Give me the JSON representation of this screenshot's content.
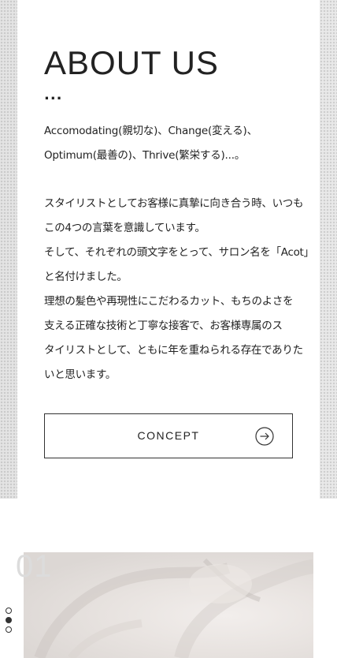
{
  "about": {
    "heading": "ABOUT US",
    "dots": "...",
    "intro": [
      "Accomodating(親切な)、Change(変える)、",
      "Optimum(最善の)、Thrive(繁栄する)...。"
    ],
    "body": [
      "スタイリストとしてお客様に真摯に向き合う時、いつも",
      "この4つの言葉を意識しています。",
      "そして、それぞれの頭文字をとって、サロン名を「Acot」",
      "と名付けました。",
      "理想の髪色や再現性にこだわるカット、もちのよさを",
      "支える正確な技術と丁寧な接客で、お客様専属のス",
      "タイリストとして、ともに年を重ねられる存在でありた",
      "いと思います。"
    ],
    "button": {
      "label": "CONCEPT",
      "icon": "arrow-right-circle-icon"
    }
  },
  "section": {
    "number": "01"
  },
  "pager": {
    "count": 3,
    "active_index": 1
  },
  "colors": {
    "text": "#222222",
    "section_number": "#dcdcdc",
    "halftone": "#c9c9c9"
  }
}
